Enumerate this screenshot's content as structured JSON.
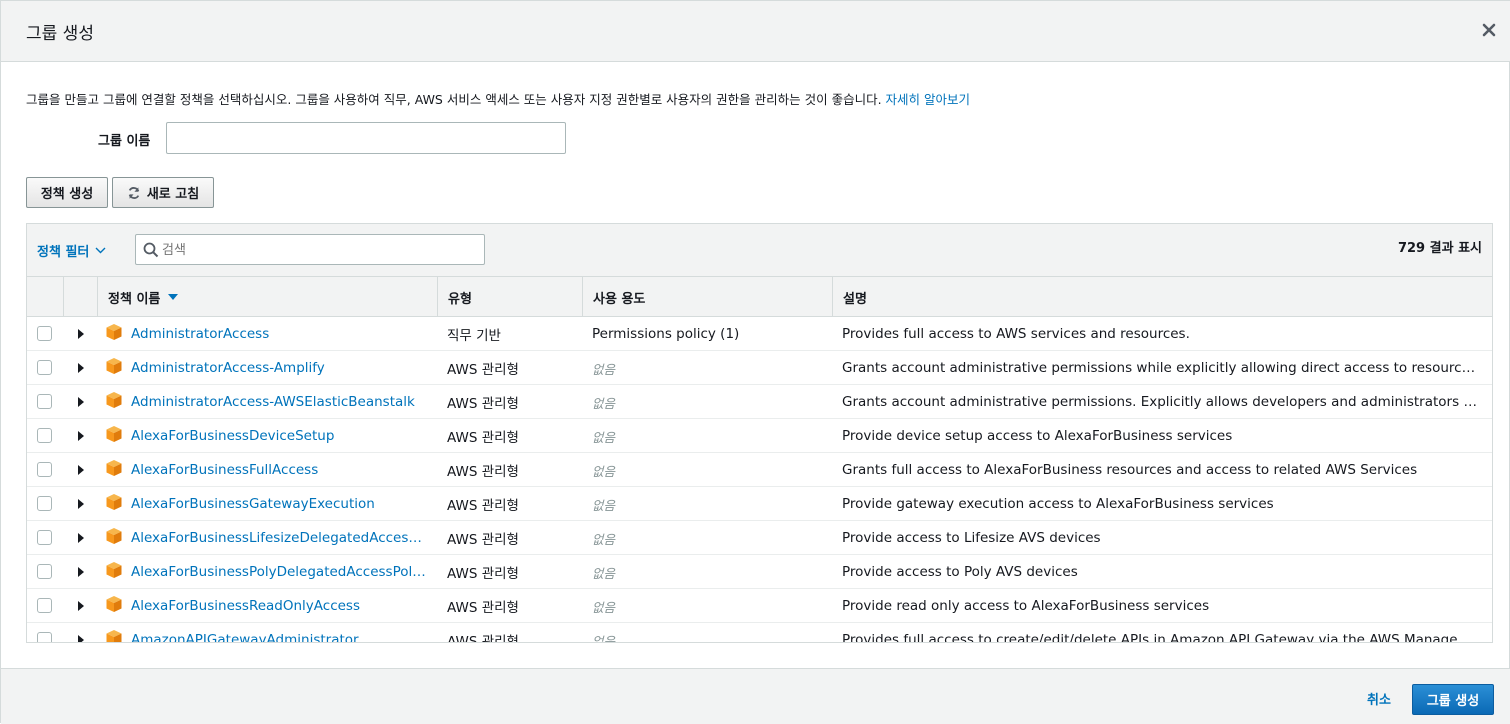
{
  "modal": {
    "title": "그룹 생성"
  },
  "intro": {
    "text": "그룹을 만들고 그룹에 연결할 정책을 선택하십시오. 그룹을 사용하여 직무, AWS 서비스 액세스 또는 사용자 지정 권한별로 사용자의 권한을 관리하는 것이 좋습니다. ",
    "link": "자세히 알아보기"
  },
  "group_name": {
    "label": "그룹 이름",
    "value": "",
    "placeholder": ""
  },
  "buttons": {
    "create_policy": "정책 생성",
    "refresh": "새로 고침"
  },
  "toolbar": {
    "filter_label": "정책 필터",
    "search_placeholder": "검색",
    "result_count": "729 결과 표시"
  },
  "table": {
    "columns": {
      "name": "정책 이름",
      "type": "유형",
      "usage": "사용 용도",
      "description": "설명"
    },
    "rows": [
      {
        "name": "AdministratorAccess",
        "type": "직무 기반",
        "usage": "Permissions policy (1)",
        "usage_none": false,
        "description": "Provides full access to AWS services and resources."
      },
      {
        "name": "AdministratorAccess-Amplify",
        "type": "AWS 관리형",
        "usage": "없음",
        "usage_none": true,
        "description": "Grants account administrative permissions while explicitly allowing direct access to resources needed by Amplify applications."
      },
      {
        "name": "AdministratorAccess-AWSElasticBeanstalk",
        "type": "AWS 관리형",
        "usage": "없음",
        "usage_none": true,
        "description": "Grants account administrative permissions. Explicitly allows developers and administrators to gain direct access to resources they need to manage AWS Elastic Beanstalk applications"
      },
      {
        "name": "AlexaForBusinessDeviceSetup",
        "type": "AWS 관리형",
        "usage": "없음",
        "usage_none": true,
        "description": "Provide device setup access to AlexaForBusiness services"
      },
      {
        "name": "AlexaForBusinessFullAccess",
        "type": "AWS 관리형",
        "usage": "없음",
        "usage_none": true,
        "description": "Grants full access to AlexaForBusiness resources and access to related AWS Services"
      },
      {
        "name": "AlexaForBusinessGatewayExecution",
        "type": "AWS 관리형",
        "usage": "없음",
        "usage_none": true,
        "description": "Provide gateway execution access to AlexaForBusiness services"
      },
      {
        "name": "AlexaForBusinessLifesizeDelegatedAccessPolicy",
        "type": "AWS 관리형",
        "usage": "없음",
        "usage_none": true,
        "description": "Provide access to Lifesize AVS devices"
      },
      {
        "name": "AlexaForBusinessPolyDelegatedAccessPolicy",
        "type": "AWS 관리형",
        "usage": "없음",
        "usage_none": true,
        "description": "Provide access to Poly AVS devices"
      },
      {
        "name": "AlexaForBusinessReadOnlyAccess",
        "type": "AWS 관리형",
        "usage": "없음",
        "usage_none": true,
        "description": "Provide read only access to AlexaForBusiness services"
      },
      {
        "name": "AmazonAPIGatewayAdministrator",
        "type": "AWS 관리형",
        "usage": "없음",
        "usage_none": true,
        "description": "Provides full access to create/edit/delete APIs in Amazon API Gateway via the AWS Management Console."
      }
    ]
  },
  "footer": {
    "cancel": "취소",
    "create_group": "그룹 생성"
  },
  "colors": {
    "link": "#0073bb",
    "primary": "#0a69b5",
    "package_icon": "#f7981d"
  }
}
